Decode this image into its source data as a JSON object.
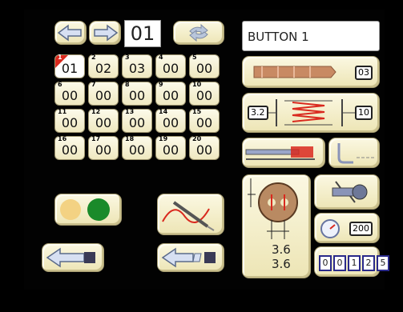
{
  "pattern_number": "01",
  "program_name": "BUTTON 1",
  "patterns": [
    {
      "slot": "1",
      "value": "01",
      "selected": true
    },
    {
      "slot": "2",
      "value": "02"
    },
    {
      "slot": "3",
      "value": "03"
    },
    {
      "slot": "4",
      "value": "00"
    },
    {
      "slot": "5",
      "value": "00"
    },
    {
      "slot": "6",
      "value": "00"
    },
    {
      "slot": "7",
      "value": "00"
    },
    {
      "slot": "8",
      "value": "00"
    },
    {
      "slot": "9",
      "value": "00"
    },
    {
      "slot": "10",
      "value": "00"
    },
    {
      "slot": "11",
      "value": "00"
    },
    {
      "slot": "12",
      "value": "00"
    },
    {
      "slot": "13",
      "value": "00"
    },
    {
      "slot": "14",
      "value": "00"
    },
    {
      "slot": "15",
      "value": "00"
    },
    {
      "slot": "16",
      "value": "00"
    },
    {
      "slot": "17",
      "value": "00"
    },
    {
      "slot": "18",
      "value": "00"
    },
    {
      "slot": "19",
      "value": "00"
    },
    {
      "slot": "20",
      "value": "00"
    }
  ],
  "thread_value": "03",
  "stitch_width": "3.2",
  "stitch_count": "10",
  "hole_spacing_x": "3.6",
  "hole_spacing_y": "3.6",
  "speed_value": "200",
  "counter_digits": [
    "0",
    "0",
    "1",
    "2",
    "5"
  ],
  "colors": {
    "yellow_lamp": "#f3d283",
    "green_lamp": "#1a8a2a",
    "red": "#d9291e",
    "panel": "#f4eec9"
  }
}
